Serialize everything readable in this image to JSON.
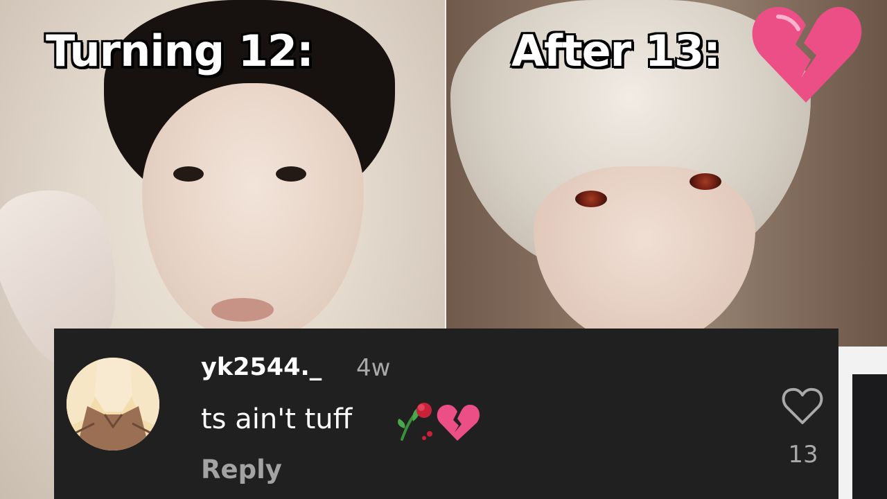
{
  "captions": {
    "left": "Turning 12:",
    "right": "After 13:"
  },
  "comment": {
    "username": "yk2544._",
    "timestamp": "4w",
    "text": "ts ain't tuff",
    "reply_label": "Reply",
    "like_count": "13"
  },
  "icons": {
    "caption_emoji": "broken-heart-icon",
    "comment_emojis": [
      "wilted-rose-icon",
      "broken-heart-icon"
    ],
    "like": "heart-outline-icon"
  },
  "colors": {
    "comment_background": "#202020",
    "username": "#ffffff",
    "muted_text": "#a9a9a9",
    "broken_heart": "#e8477a"
  }
}
